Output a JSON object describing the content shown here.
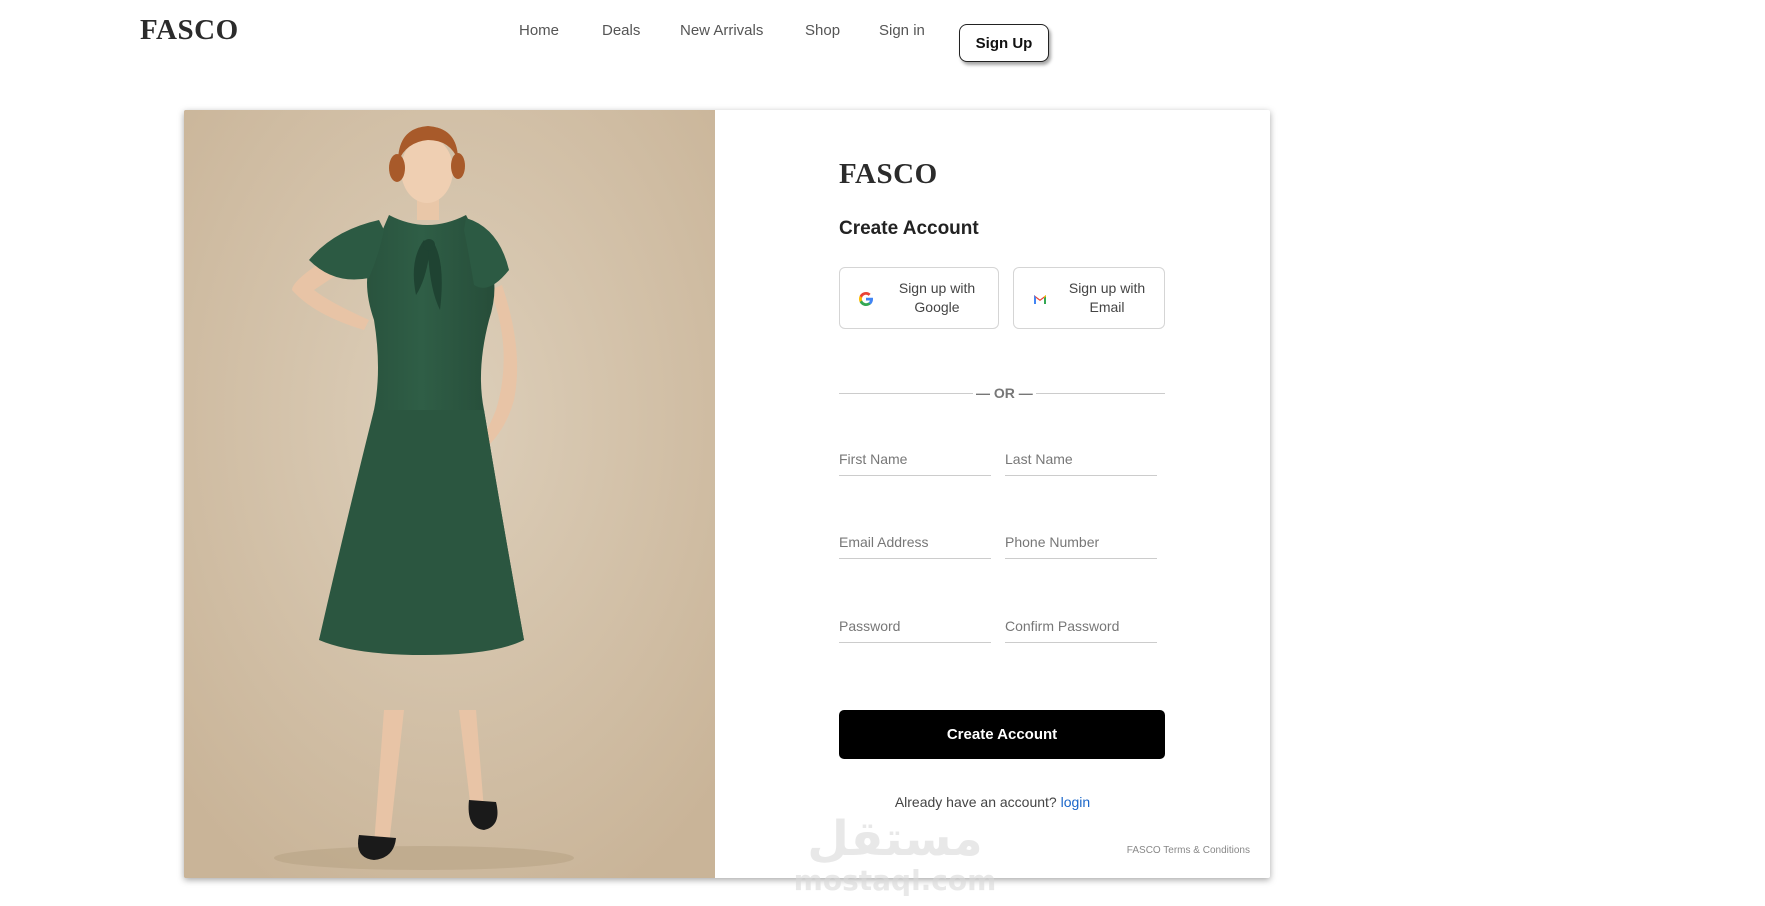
{
  "brand": "FASCO",
  "nav": {
    "items": [
      {
        "label": "Home"
      },
      {
        "label": "Deals"
      },
      {
        "label": "New Arrivals"
      },
      {
        "label": "Shop"
      },
      {
        "label": "Sign in"
      }
    ],
    "signup_label": "Sign Up"
  },
  "form": {
    "brand": "FASCO",
    "title": "Create Account",
    "google_label": "Sign up with Google",
    "email_label": "Sign up with Email",
    "divider": "— OR —",
    "first_name_placeholder": "First Name",
    "last_name_placeholder": "Last Name",
    "email_placeholder": "Email Address",
    "phone_placeholder": "Phone Number",
    "password_placeholder": "Password",
    "confirm_password_placeholder": "Confirm Password",
    "submit_label": "Create Account",
    "already_text": "Already have an account?",
    "login_label": "login",
    "terms": "FASCO Terms & Conditions"
  },
  "icons": {
    "google": "google-icon",
    "email": "gmail-icon"
  },
  "colors": {
    "accent": "#000000",
    "link": "#1a66c9",
    "hero_bg": "#d3c1a8",
    "dress": "#2f5b45"
  },
  "watermark": {
    "text_arabic": "مستقل",
    "text_latin": "mostaql.com"
  }
}
